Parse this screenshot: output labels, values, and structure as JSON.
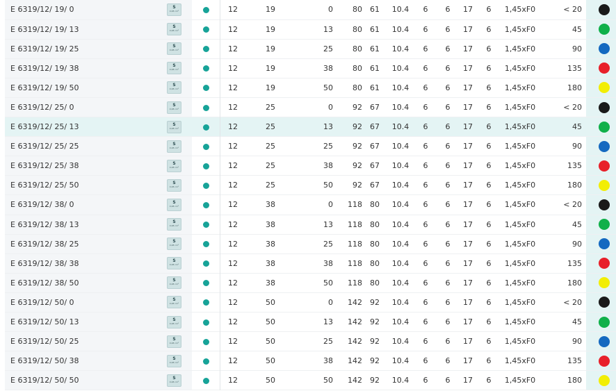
{
  "badge_letter": "S",
  "badge_sub": "0,08 cm²",
  "status_color": "#17a398",
  "colors": {
    "< 20": "#1a1a1a",
    "45": "#10b04a",
    "90": "#1469c0",
    "135": "#e8202a",
    "180": "#f2ee05"
  },
  "highlighted_row": 6,
  "rows": [
    {
      "name": "E 6319/12/ 19/ 0",
      "d": "12",
      "dd": "19",
      "l": "0",
      "d1": "80",
      "d2": "61",
      "b": "10.4",
      "s": "6",
      "t": "6",
      "h": "17",
      "x": "6",
      "th": "1,45xF0",
      "ang": "< 20",
      "color": "< 20"
    },
    {
      "name": "E 6319/12/ 19/ 13",
      "d": "12",
      "dd": "19",
      "l": "13",
      "d1": "80",
      "d2": "61",
      "b": "10.4",
      "s": "6",
      "t": "6",
      "h": "17",
      "x": "6",
      "th": "1,45xF0",
      "ang": "45",
      "color": "45"
    },
    {
      "name": "E 6319/12/ 19/ 25",
      "d": "12",
      "dd": "19",
      "l": "25",
      "d1": "80",
      "d2": "61",
      "b": "10.4",
      "s": "6",
      "t": "6",
      "h": "17",
      "x": "6",
      "th": "1,45xF0",
      "ang": "90",
      "color": "90"
    },
    {
      "name": "E 6319/12/ 19/ 38",
      "d": "12",
      "dd": "19",
      "l": "38",
      "d1": "80",
      "d2": "61",
      "b": "10.4",
      "s": "6",
      "t": "6",
      "h": "17",
      "x": "6",
      "th": "1,45xF0",
      "ang": "135",
      "color": "135"
    },
    {
      "name": "E 6319/12/ 19/ 50",
      "d": "12",
      "dd": "19",
      "l": "50",
      "d1": "80",
      "d2": "61",
      "b": "10.4",
      "s": "6",
      "t": "6",
      "h": "17",
      "x": "6",
      "th": "1,45xF0",
      "ang": "180",
      "color": "180"
    },
    {
      "name": "E 6319/12/ 25/ 0",
      "d": "12",
      "dd": "25",
      "l": "0",
      "d1": "92",
      "d2": "67",
      "b": "10.4",
      "s": "6",
      "t": "6",
      "h": "17",
      "x": "6",
      "th": "1,45xF0",
      "ang": "< 20",
      "color": "< 20"
    },
    {
      "name": "E 6319/12/ 25/ 13",
      "d": "12",
      "dd": "25",
      "l": "13",
      "d1": "92",
      "d2": "67",
      "b": "10.4",
      "s": "6",
      "t": "6",
      "h": "17",
      "x": "6",
      "th": "1,45xF0",
      "ang": "45",
      "color": "45"
    },
    {
      "name": "E 6319/12/ 25/ 25",
      "d": "12",
      "dd": "25",
      "l": "25",
      "d1": "92",
      "d2": "67",
      "b": "10.4",
      "s": "6",
      "t": "6",
      "h": "17",
      "x": "6",
      "th": "1,45xF0",
      "ang": "90",
      "color": "90"
    },
    {
      "name": "E 6319/12/ 25/ 38",
      "d": "12",
      "dd": "25",
      "l": "38",
      "d1": "92",
      "d2": "67",
      "b": "10.4",
      "s": "6",
      "t": "6",
      "h": "17",
      "x": "6",
      "th": "1,45xF0",
      "ang": "135",
      "color": "135"
    },
    {
      "name": "E 6319/12/ 25/ 50",
      "d": "12",
      "dd": "25",
      "l": "50",
      "d1": "92",
      "d2": "67",
      "b": "10.4",
      "s": "6",
      "t": "6",
      "h": "17",
      "x": "6",
      "th": "1,45xF0",
      "ang": "180",
      "color": "180"
    },
    {
      "name": "E 6319/12/ 38/ 0",
      "d": "12",
      "dd": "38",
      "l": "0",
      "d1": "118",
      "d2": "80",
      "b": "10.4",
      "s": "6",
      "t": "6",
      "h": "17",
      "x": "6",
      "th": "1,45xF0",
      "ang": "< 20",
      "color": "< 20"
    },
    {
      "name": "E 6319/12/ 38/ 13",
      "d": "12",
      "dd": "38",
      "l": "13",
      "d1": "118",
      "d2": "80",
      "b": "10.4",
      "s": "6",
      "t": "6",
      "h": "17",
      "x": "6",
      "th": "1,45xF0",
      "ang": "45",
      "color": "45"
    },
    {
      "name": "E 6319/12/ 38/ 25",
      "d": "12",
      "dd": "38",
      "l": "25",
      "d1": "118",
      "d2": "80",
      "b": "10.4",
      "s": "6",
      "t": "6",
      "h": "17",
      "x": "6",
      "th": "1,45xF0",
      "ang": "90",
      "color": "90"
    },
    {
      "name": "E 6319/12/ 38/ 38",
      "d": "12",
      "dd": "38",
      "l": "38",
      "d1": "118",
      "d2": "80",
      "b": "10.4",
      "s": "6",
      "t": "6",
      "h": "17",
      "x": "6",
      "th": "1,45xF0",
      "ang": "135",
      "color": "135"
    },
    {
      "name": "E 6319/12/ 38/ 50",
      "d": "12",
      "dd": "38",
      "l": "50",
      "d1": "118",
      "d2": "80",
      "b": "10.4",
      "s": "6",
      "t": "6",
      "h": "17",
      "x": "6",
      "th": "1,45xF0",
      "ang": "180",
      "color": "180"
    },
    {
      "name": "E 6319/12/ 50/ 0",
      "d": "12",
      "dd": "50",
      "l": "0",
      "d1": "142",
      "d2": "92",
      "b": "10.4",
      "s": "6",
      "t": "6",
      "h": "17",
      "x": "6",
      "th": "1,45xF0",
      "ang": "< 20",
      "color": "< 20"
    },
    {
      "name": "E 6319/12/ 50/ 13",
      "d": "12",
      "dd": "50",
      "l": "13",
      "d1": "142",
      "d2": "92",
      "b": "10.4",
      "s": "6",
      "t": "6",
      "h": "17",
      "x": "6",
      "th": "1,45xF0",
      "ang": "45",
      "color": "45"
    },
    {
      "name": "E 6319/12/ 50/ 25",
      "d": "12",
      "dd": "50",
      "l": "25",
      "d1": "142",
      "d2": "92",
      "b": "10.4",
      "s": "6",
      "t": "6",
      "h": "17",
      "x": "6",
      "th": "1,45xF0",
      "ang": "90",
      "color": "90"
    },
    {
      "name": "E 6319/12/ 50/ 38",
      "d": "12",
      "dd": "50",
      "l": "38",
      "d1": "142",
      "d2": "92",
      "b": "10.4",
      "s": "6",
      "t": "6",
      "h": "17",
      "x": "6",
      "th": "1,45xF0",
      "ang": "135",
      "color": "135"
    },
    {
      "name": "E 6319/12/ 50/ 50",
      "d": "12",
      "dd": "50",
      "l": "50",
      "d1": "142",
      "d2": "92",
      "b": "10.4",
      "s": "6",
      "t": "6",
      "h": "17",
      "x": "6",
      "th": "1,45xF0",
      "ang": "180",
      "color": "180"
    }
  ]
}
